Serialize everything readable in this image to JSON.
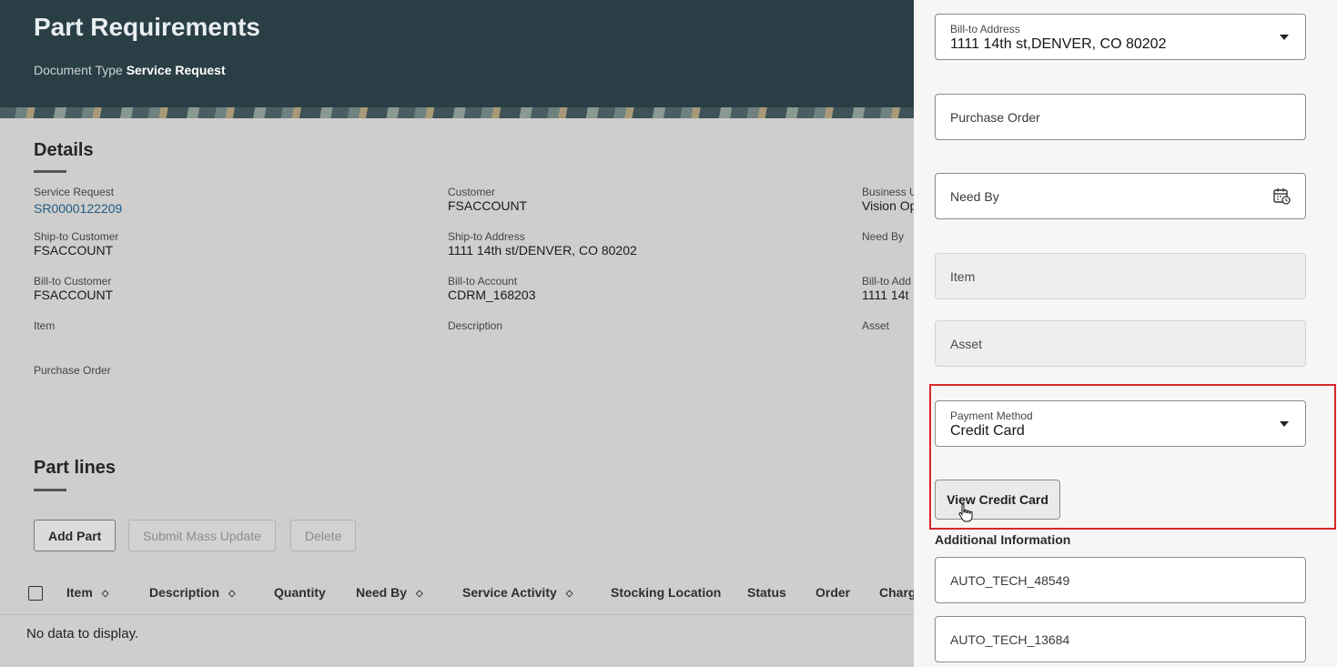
{
  "header": {
    "title": "Part Requirements",
    "doc_type_label": "Document Type",
    "doc_type_value": "Service Request"
  },
  "details": {
    "section_title": "Details",
    "service_request_label": "Service Request",
    "service_request_value": "SR0000122209",
    "customer_label": "Customer",
    "customer_value": "FSACCOUNT",
    "business_unit_label": "Business U",
    "business_unit_value": "Vision Op",
    "ship_to_customer_label": "Ship-to Customer",
    "ship_to_customer_value": "FSACCOUNT",
    "ship_to_address_label": "Ship-to Address",
    "ship_to_address_value": "1111 14th st/DENVER, CO 80202",
    "need_by_label": "Need By",
    "bill_to_customer_label": "Bill-to Customer",
    "bill_to_customer_value": "FSACCOUNT",
    "bill_to_account_label": "Bill-to Account",
    "bill_to_account_value": "CDRM_168203",
    "bill_to_address_label": "Bill-to Add",
    "bill_to_address_value": "1111 14t",
    "item_label": "Item",
    "description_label": "Description",
    "asset_label": "Asset",
    "purchase_order_label": "Purchase Order"
  },
  "part_lines": {
    "section_title": "Part lines",
    "add_part": "Add Part",
    "submit_mass_update": "Submit Mass Update",
    "delete": "Delete",
    "columns": [
      "Item",
      "Description",
      "Quantity",
      "Need By",
      "Service Activity",
      "Stocking Location",
      "Status",
      "Order",
      "Charg"
    ],
    "empty_text": "No data to display."
  },
  "drawer": {
    "bill_to_address": {
      "label": "Bill-to Address",
      "value": "1111 14th st,DENVER, CO 80202"
    },
    "purchase_order": {
      "placeholder": "Purchase Order"
    },
    "need_by": {
      "placeholder": "Need By"
    },
    "item": {
      "placeholder": "Item"
    },
    "asset": {
      "placeholder": "Asset"
    },
    "payment_method": {
      "label": "Payment Method",
      "value": "Credit Card"
    },
    "view_credit_card": "View Credit Card",
    "additional_information": "Additional Information",
    "additional_fields": [
      "AUTO_TECH_48549",
      "AUTO_TECH_13684"
    ]
  },
  "colors": {
    "header_bg": "#2a3e45",
    "highlight": "#d8262c",
    "link": "#1f5a85"
  }
}
